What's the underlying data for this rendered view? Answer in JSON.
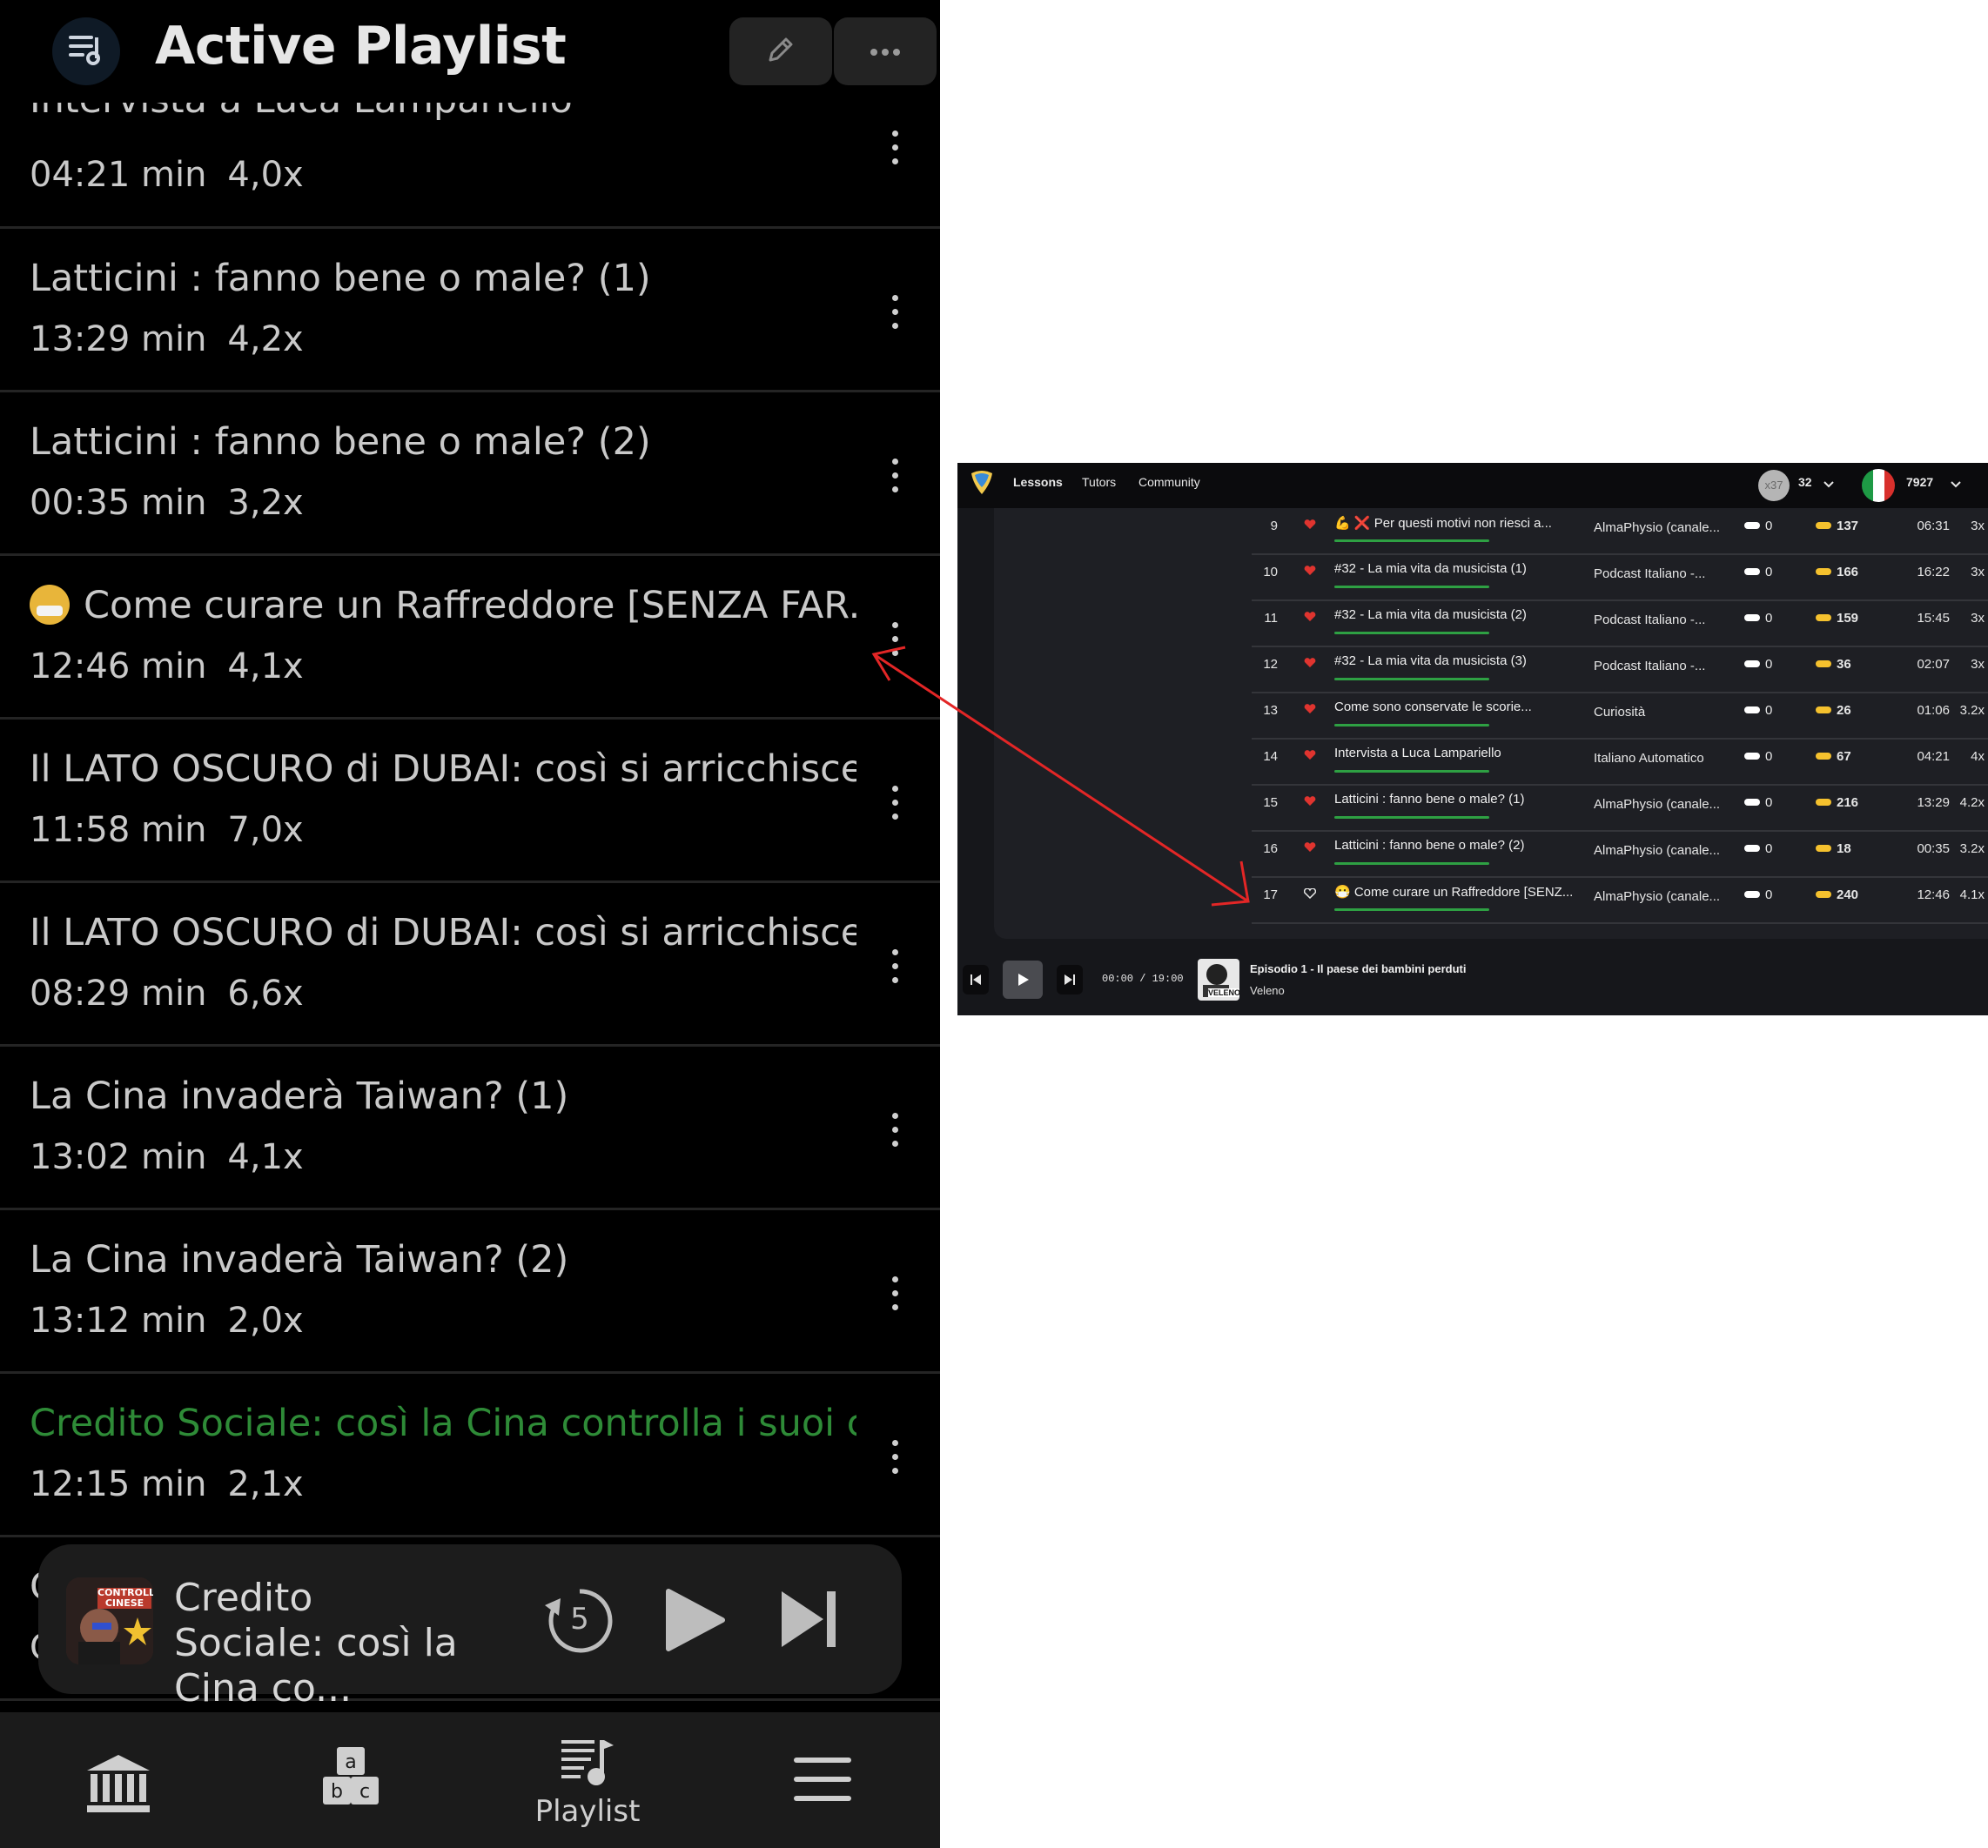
{
  "mobile": {
    "header": {
      "title": "Active Playlist",
      "avatar_icon": "playlist-music-icon",
      "edit_icon": "pencil-icon",
      "more_icon": "ellipsis-icon"
    },
    "playlist": [
      {
        "title": "Intervista a Luca Lampariello",
        "duration": "04:21 min",
        "speed": "4,0x",
        "active": false,
        "emoji": false
      },
      {
        "title": "Latticini : fanno bene o male? (1)",
        "duration": "13:29 min",
        "speed": "4,2x",
        "active": false,
        "emoji": false
      },
      {
        "title": "Latticini : fanno bene o male? (2)",
        "duration": "00:35 min",
        "speed": "3,2x",
        "active": false,
        "emoji": false
      },
      {
        "title": "Come curare un Raffreddore [SENZA FAR...",
        "duration": "12:46 min",
        "speed": "4,1x",
        "active": false,
        "emoji": true
      },
      {
        "title": "Il LATO OSCURO di DUBAI: così si arricchisce l...",
        "duration": "11:58 min",
        "speed": "7,0x",
        "active": false,
        "emoji": false
      },
      {
        "title": "Il LATO OSCURO di DUBAI: così si arricchisce l...",
        "duration": "08:29 min",
        "speed": "6,6x",
        "active": false,
        "emoji": false
      },
      {
        "title": "La Cina invaderà Taiwan? (1)",
        "duration": "13:02 min",
        "speed": "4,1x",
        "active": false,
        "emoji": false
      },
      {
        "title": "La Cina invaderà Taiwan? (2)",
        "duration": "13:12 min",
        "speed": "2,0x",
        "active": false,
        "emoji": false
      },
      {
        "title": "Credito Sociale: così la Cina controlla i suoi ci...",
        "duration": "12:15 min",
        "speed": "2,1x",
        "active": true,
        "emoji": false
      },
      {
        "title": "C",
        "duration": "C",
        "speed": "",
        "active": false,
        "emoji": false
      }
    ],
    "player": {
      "title": "Credito Sociale: così la Cina co...",
      "thumb_label": "CONTROLLO CINESE",
      "replay_seconds": "5"
    },
    "bottom_nav": [
      {
        "label": "",
        "icon": "library-icon"
      },
      {
        "label": "",
        "icon": "abc-blocks-icon"
      },
      {
        "label": "Playlist",
        "icon": "playlist-icon"
      },
      {
        "label": "",
        "icon": "menu-icon"
      }
    ]
  },
  "desktop": {
    "nav": [
      "Lessons",
      "Tutors",
      "Community"
    ],
    "streak_badge": "x37",
    "streak_count": "32",
    "score": "7927",
    "rows": [
      {
        "num": "9",
        "liked": true,
        "title": "💪 ❌ Per questi motivi non riesci a...",
        "source": "AlmaPhysio (canale...",
        "c1": "0",
        "c2": "137",
        "time": "06:31",
        "speed": "3x"
      },
      {
        "num": "10",
        "liked": true,
        "title": "#32 - La mia vita da musicista (1)",
        "source": "Podcast Italiano -...",
        "c1": "0",
        "c2": "166",
        "time": "16:22",
        "speed": "3x"
      },
      {
        "num": "11",
        "liked": true,
        "title": "#32 - La mia vita da musicista (2)",
        "source": "Podcast Italiano -...",
        "c1": "0",
        "c2": "159",
        "time": "15:45",
        "speed": "3x"
      },
      {
        "num": "12",
        "liked": true,
        "title": "#32 - La mia vita da musicista (3)",
        "source": "Podcast Italiano -...",
        "c1": "0",
        "c2": "36",
        "time": "02:07",
        "speed": "3x"
      },
      {
        "num": "13",
        "liked": true,
        "title": "Come sono conservate le scorie...",
        "source": "Curiosità",
        "c1": "0",
        "c2": "26",
        "time": "01:06",
        "speed": "3.2x"
      },
      {
        "num": "14",
        "liked": true,
        "title": "Intervista a Luca Lampariello",
        "source": "Italiano Automatico",
        "c1": "0",
        "c2": "67",
        "time": "04:21",
        "speed": "4x"
      },
      {
        "num": "15",
        "liked": true,
        "title": "Latticini : fanno bene o male? (1)",
        "source": "AlmaPhysio (canale...",
        "c1": "0",
        "c2": "216",
        "time": "13:29",
        "speed": "4.2x"
      },
      {
        "num": "16",
        "liked": true,
        "title": "Latticini : fanno bene o male? (2)",
        "source": "AlmaPhysio (canale...",
        "c1": "0",
        "c2": "18",
        "time": "00:35",
        "speed": "3.2x"
      },
      {
        "num": "17",
        "liked": false,
        "title": "😷 Come curare un Raffreddore [SENZ...",
        "source": "AlmaPhysio (canale...",
        "c1": "0",
        "c2": "240",
        "time": "12:46",
        "speed": "4.1x"
      }
    ],
    "player": {
      "time": "00:00 / 19:00",
      "title": "Episodio 1 - Il paese dei bambini perduti",
      "artist": "Veleno",
      "thumb_label": "VELENO"
    }
  },
  "colors": {
    "active_green": "#2e8b37",
    "heart_red": "#e0342f",
    "annotation_arrow": "#e32626",
    "pill_yellow": "#f5c12e"
  }
}
